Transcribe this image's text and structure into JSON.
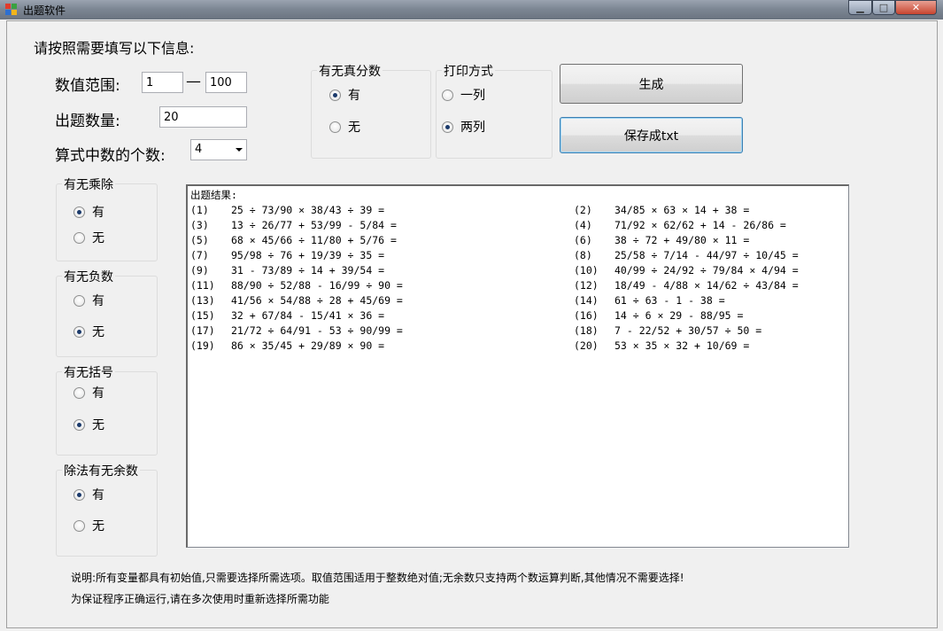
{
  "window": {
    "title": "出题软件",
    "min_label": "▁",
    "max_label": "□",
    "close_label": "✕"
  },
  "form": {
    "intro": "请按照需要填写以下信息:",
    "range_label": "数值范围:",
    "range_sep": "—",
    "range_min": "1",
    "range_max": "100",
    "count_label": "出题数量:",
    "count_value": "20",
    "terms_label": "算式中数的个数:",
    "terms_value": "4"
  },
  "groups": {
    "fraction": {
      "title": "有无真分数",
      "options": [
        "有",
        "无"
      ],
      "selected": 0
    },
    "print": {
      "title": "打印方式",
      "options": [
        "一列",
        "两列"
      ],
      "selected": 1
    },
    "muldiv": {
      "title": "有无乘除",
      "options": [
        "有",
        "无"
      ],
      "selected": 0
    },
    "negative": {
      "title": "有无负数",
      "options": [
        "有",
        "无"
      ],
      "selected": 1
    },
    "bracket": {
      "title": "有无括号",
      "options": [
        "有",
        "无"
      ],
      "selected": 1
    },
    "remainder": {
      "title": "除法有无余数",
      "options": [
        "有",
        "无"
      ],
      "selected": 0
    }
  },
  "buttons": {
    "generate": "生成",
    "save": "保存成txt"
  },
  "output": {
    "header": "出题结果:",
    "rows": [
      {
        "ln": "(1)",
        "le": "25 ÷ 73/90 × 38/43 ÷ 39 =",
        "rn": "(2)",
        "re": "34/85 × 63 × 14 + 38 ="
      },
      {
        "ln": "(3)",
        "le": "13 ÷ 26/77 + 53/99 - 5/84 =",
        "rn": "(4)",
        "re": "71/92 × 62/62 + 14 - 26/86 ="
      },
      {
        "ln": "(5)",
        "le": "68 × 45/66 ÷ 11/80 + 5/76 =",
        "rn": "(6)",
        "re": "38 ÷ 72 + 49/80 × 11 ="
      },
      {
        "ln": "(7)",
        "le": "95/98 ÷ 76 + 19/39 ÷ 35 =",
        "rn": "(8)",
        "re": "25/58 ÷ 7/14 - 44/97 ÷ 10/45 ="
      },
      {
        "ln": "(9)",
        "le": "31 - 73/89 ÷ 14 + 39/54 =",
        "rn": "(10)",
        "re": "40/99 ÷ 24/92 ÷ 79/84 × 4/94 ="
      },
      {
        "ln": "(11)",
        "le": "88/90 ÷ 52/88 - 16/99 ÷ 90 =",
        "rn": "(12)",
        "re": "18/49 - 4/88 × 14/62 ÷ 43/84 ="
      },
      {
        "ln": "(13)",
        "le": "41/56 × 54/88 ÷ 28 + 45/69 =",
        "rn": "(14)",
        "re": "61 ÷ 63 - 1 - 38 ="
      },
      {
        "ln": "(15)",
        "le": "32 + 67/84 - 15/41 × 36 =",
        "rn": "(16)",
        "re": "14 ÷ 6 × 29 - 88/95 ="
      },
      {
        "ln": "(17)",
        "le": "21/72 ÷ 64/91 - 53 ÷ 90/99 =",
        "rn": "(18)",
        "re": "7 - 22/52 + 30/57 ÷ 50 ="
      },
      {
        "ln": "(19)",
        "le": "86 × 35/45 + 29/89 × 90 =",
        "rn": "(20)",
        "re": "53 × 35 × 32 + 10/69 ="
      }
    ]
  },
  "notes": {
    "line1": "说明:所有变量都具有初始值,只需要选择所需选项。取值范围适用于整数绝对值;无余数只支持两个数运算判断,其他情况不需要选择!",
    "line2": "为保证程序正确运行,请在多次使用时重新选择所需功能"
  }
}
